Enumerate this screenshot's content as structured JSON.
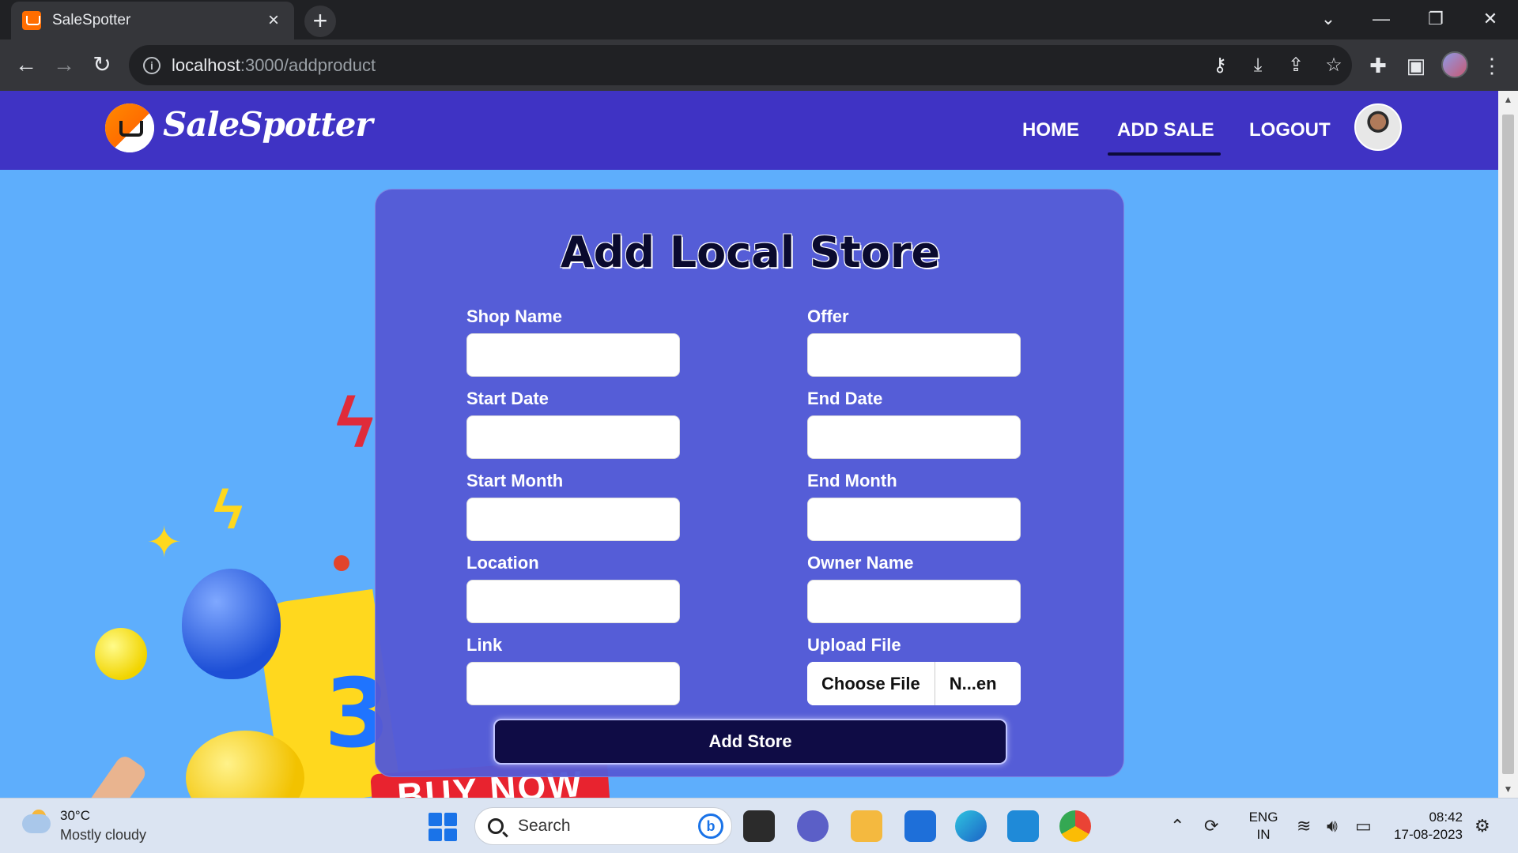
{
  "browser": {
    "tab_title": "SaleSpotter",
    "tab_close": "×",
    "new_tab": "+",
    "url_host": "localhost",
    "url_path": ":3000/addproduct"
  },
  "site": {
    "brand": "SaleSpotter",
    "nav": [
      {
        "label": "HOME",
        "active": false
      },
      {
        "label": "ADD SALE",
        "active": true
      },
      {
        "label": "LOGOUT",
        "active": false
      }
    ]
  },
  "form": {
    "title": "Add Local Store",
    "fields": {
      "shop_name": "Shop Name",
      "offer": "Offer",
      "start_date": "Start Date",
      "end_date": "End Date",
      "start_month": "Start Month",
      "end_month": "End Month",
      "location": "Location",
      "owner_name": "Owner Name",
      "link": "Link",
      "upload_file": "Upload File"
    },
    "choose_file": "Choose File",
    "file_name": "N...en",
    "submit": "Add Store"
  },
  "background": {
    "promo_text": "BUY NOW",
    "digit": "3"
  },
  "taskbar": {
    "temperature": "30°C",
    "weather": "Mostly cloudy",
    "search_placeholder": "Search",
    "lang_1": "ENG",
    "lang_2": "IN",
    "time": "08:42",
    "date": "17-08-2023"
  },
  "colors": {
    "navbar": "#3f33c4",
    "page_bg": "#5eaefc",
    "card": "#545ad5",
    "submit": "#0f0c45"
  }
}
